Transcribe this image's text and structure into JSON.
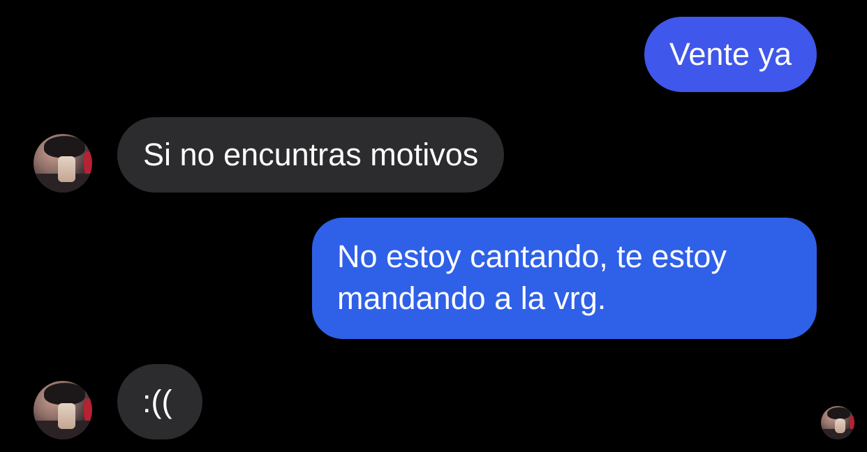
{
  "conversation": {
    "messages": [
      {
        "sender": "me",
        "text": "Vente ya"
      },
      {
        "sender": "them",
        "text": "Si no encuntras motivos"
      },
      {
        "sender": "me",
        "text": "No estoy cantando, te estoy mandando a la vrg."
      },
      {
        "sender": "them",
        "text": ":(("
      }
    ]
  },
  "colors": {
    "background": "#000000",
    "outgoing_bubble_top": "#3f57ea",
    "outgoing_bubble_bottom": "#2f60e8",
    "incoming_bubble": "#2c2c2e",
    "text": "#ffffff"
  },
  "icons": {
    "contact_avatar": "contact-avatar-photo",
    "read_receipt": "read-receipt-avatar"
  }
}
